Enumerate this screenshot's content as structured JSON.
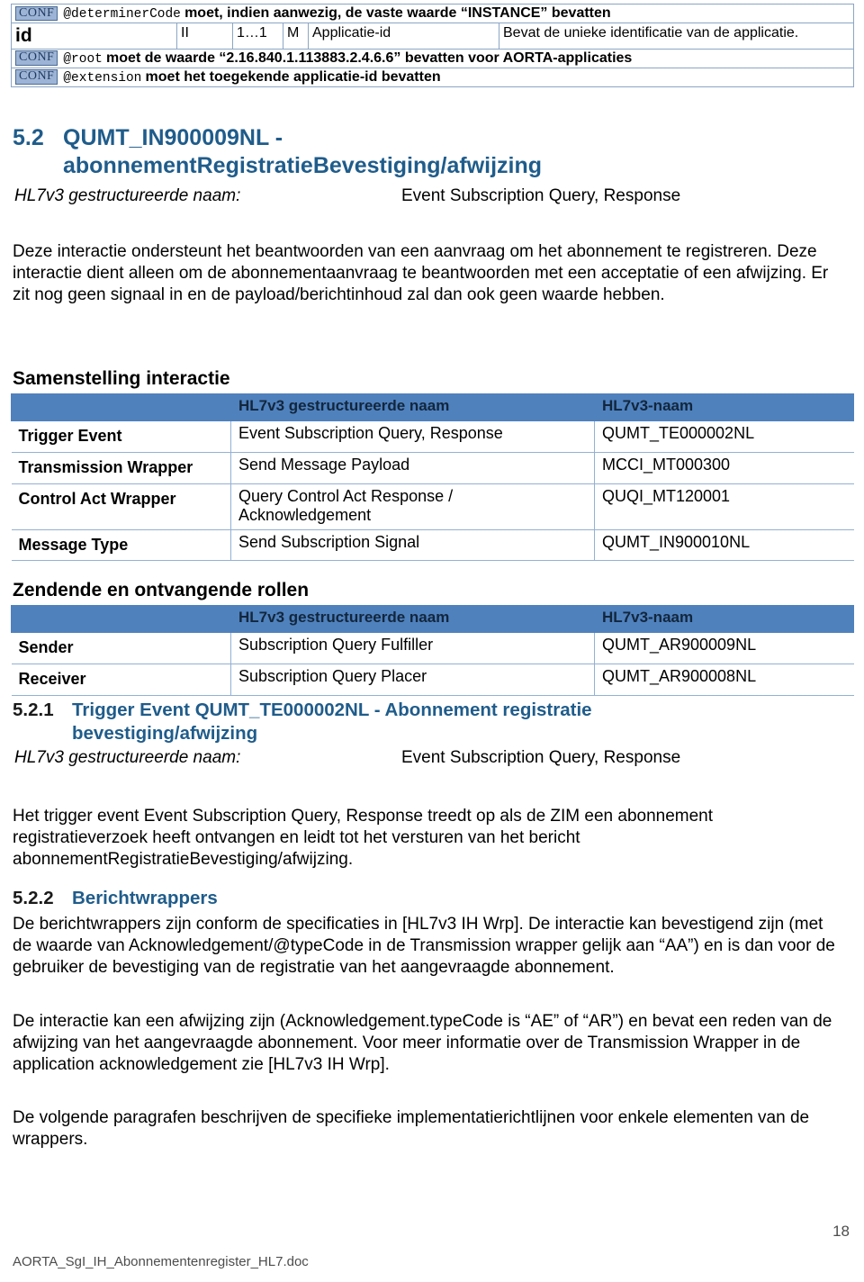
{
  "attribute_table": {
    "conf_badge_label": "CONF",
    "rows": [
      {
        "type": "conf",
        "code": "@determinerCode",
        "text": "moet, indien aanwezig, de vaste waarde “INSTANCE” bevatten"
      },
      {
        "type": "attr",
        "name": "id",
        "datatype": "II",
        "cardinality": "1…1",
        "usage": "M",
        "label": "Applicatie-id",
        "description": "Bevat de unieke identificatie van de applicatie."
      },
      {
        "type": "conf",
        "code": "@root",
        "text": "moet de waarde “2.16.840.1.113883.2.4.6.6” bevatten voor AORTA-applicaties"
      },
      {
        "type": "conf",
        "code": "@extension",
        "text": "moet het toegekende applicatie-id bevatten"
      }
    ]
  },
  "section_5_2": {
    "number": "5.2",
    "title_line1": "QUMT_IN900009NL -",
    "title_line2": "abonnementRegistratieBevestiging/afwijzing",
    "subtitle_label": "HL7v3 gestructureerde naam:",
    "subtitle_value": "Event Subscription Query, Response",
    "body": "Deze interactie ondersteunt het beantwoorden van een aanvraag om het abonnement te registreren. Deze interactie dient alleen om de abonnementaanvraag te beantwoorden met een acceptatie of een afwijzing. Er zit nog geen signaal in en de payload/berichtinhoud zal dan ook geen waarde hebben."
  },
  "samenstelling": {
    "heading": "Samenstelling interactie",
    "columns": [
      "",
      "HL7v3 gestructureerde naam",
      "HL7v3-naam"
    ],
    "rows": [
      {
        "label": "Trigger Event",
        "structured_name": "Event Subscription Query, Response",
        "hl7_name": "QUMT_TE000002NL"
      },
      {
        "label": "Transmission Wrapper",
        "structured_name": "Send Message Payload",
        "hl7_name": "MCCI_MT000300"
      },
      {
        "label": "Control Act Wrapper",
        "structured_name": "Query Control Act Response / Acknowledgement",
        "hl7_name": "QUQI_MT120001"
      },
      {
        "label": "Message Type",
        "structured_name": "Send Subscription Signal",
        "hl7_name": "QUMT_IN900010NL"
      }
    ]
  },
  "rollen": {
    "heading": "Zendende en ontvangende rollen",
    "columns": [
      "",
      "HL7v3 gestructureerde naam",
      "HL7v3-naam"
    ],
    "rows": [
      {
        "label": "Sender",
        "structured_name": "Subscription Query Fulfiller",
        "hl7_name": "QUMT_AR900009NL"
      },
      {
        "label": "Receiver",
        "structured_name": "Subscription Query Placer",
        "hl7_name": "QUMT_AR900008NL"
      }
    ]
  },
  "section_5_2_1": {
    "number": "5.2.1",
    "title_line1": "Trigger Event QUMT_TE000002NL - Abonnement registratie",
    "title_line2": "bevestiging/afwijzing",
    "subtitle_label": "HL7v3 gestructureerde naam:",
    "subtitle_value": "Event Subscription Query, Response",
    "body": "Het trigger event Event Subscription Query, Response treedt op als de ZIM een abonnement registratieverzoek heeft ontvangen en leidt tot het versturen van het bericht abonnementRegistratieBevestiging/afwijzing."
  },
  "section_5_2_2": {
    "number": "5.2.2",
    "title": "Berichtwrappers",
    "paragraph_1": "De berichtwrappers zijn conform de specificaties in [HL7v3 IH Wrp]. De interactie kan bevestigend zijn (met de waarde van Acknowledgement/@typeCode in de Transmission wrapper gelijk aan “AA”) en is dan voor de gebruiker de bevestiging van de registratie van het aangevraagde abonnement.",
    "paragraph_2": "De interactie kan een afwijzing zijn (Acknowledgement.typeCode is “AE” of “AR”) en bevat een reden van de afwijzing van het aangevraagde abonnement. Voor meer informatie over de Transmission Wrapper in de application acknowledgement zie [HL7v3 IH Wrp].",
    "paragraph_3": "De volgende paragrafen beschrijven de specifieke implementatierichtlijnen voor enkele elementen van de wrappers."
  },
  "footer": {
    "file_name": "AORTA_SgI_IH_Abonnementenregister_HL7.doc",
    "page_number": "18"
  },
  "colors": {
    "heading_blue": "#1f5c8b",
    "table_header_blue": "#4f81bd",
    "table_border_blue": "#93b0d4",
    "conf_badge_bg": "#9db4d6"
  }
}
